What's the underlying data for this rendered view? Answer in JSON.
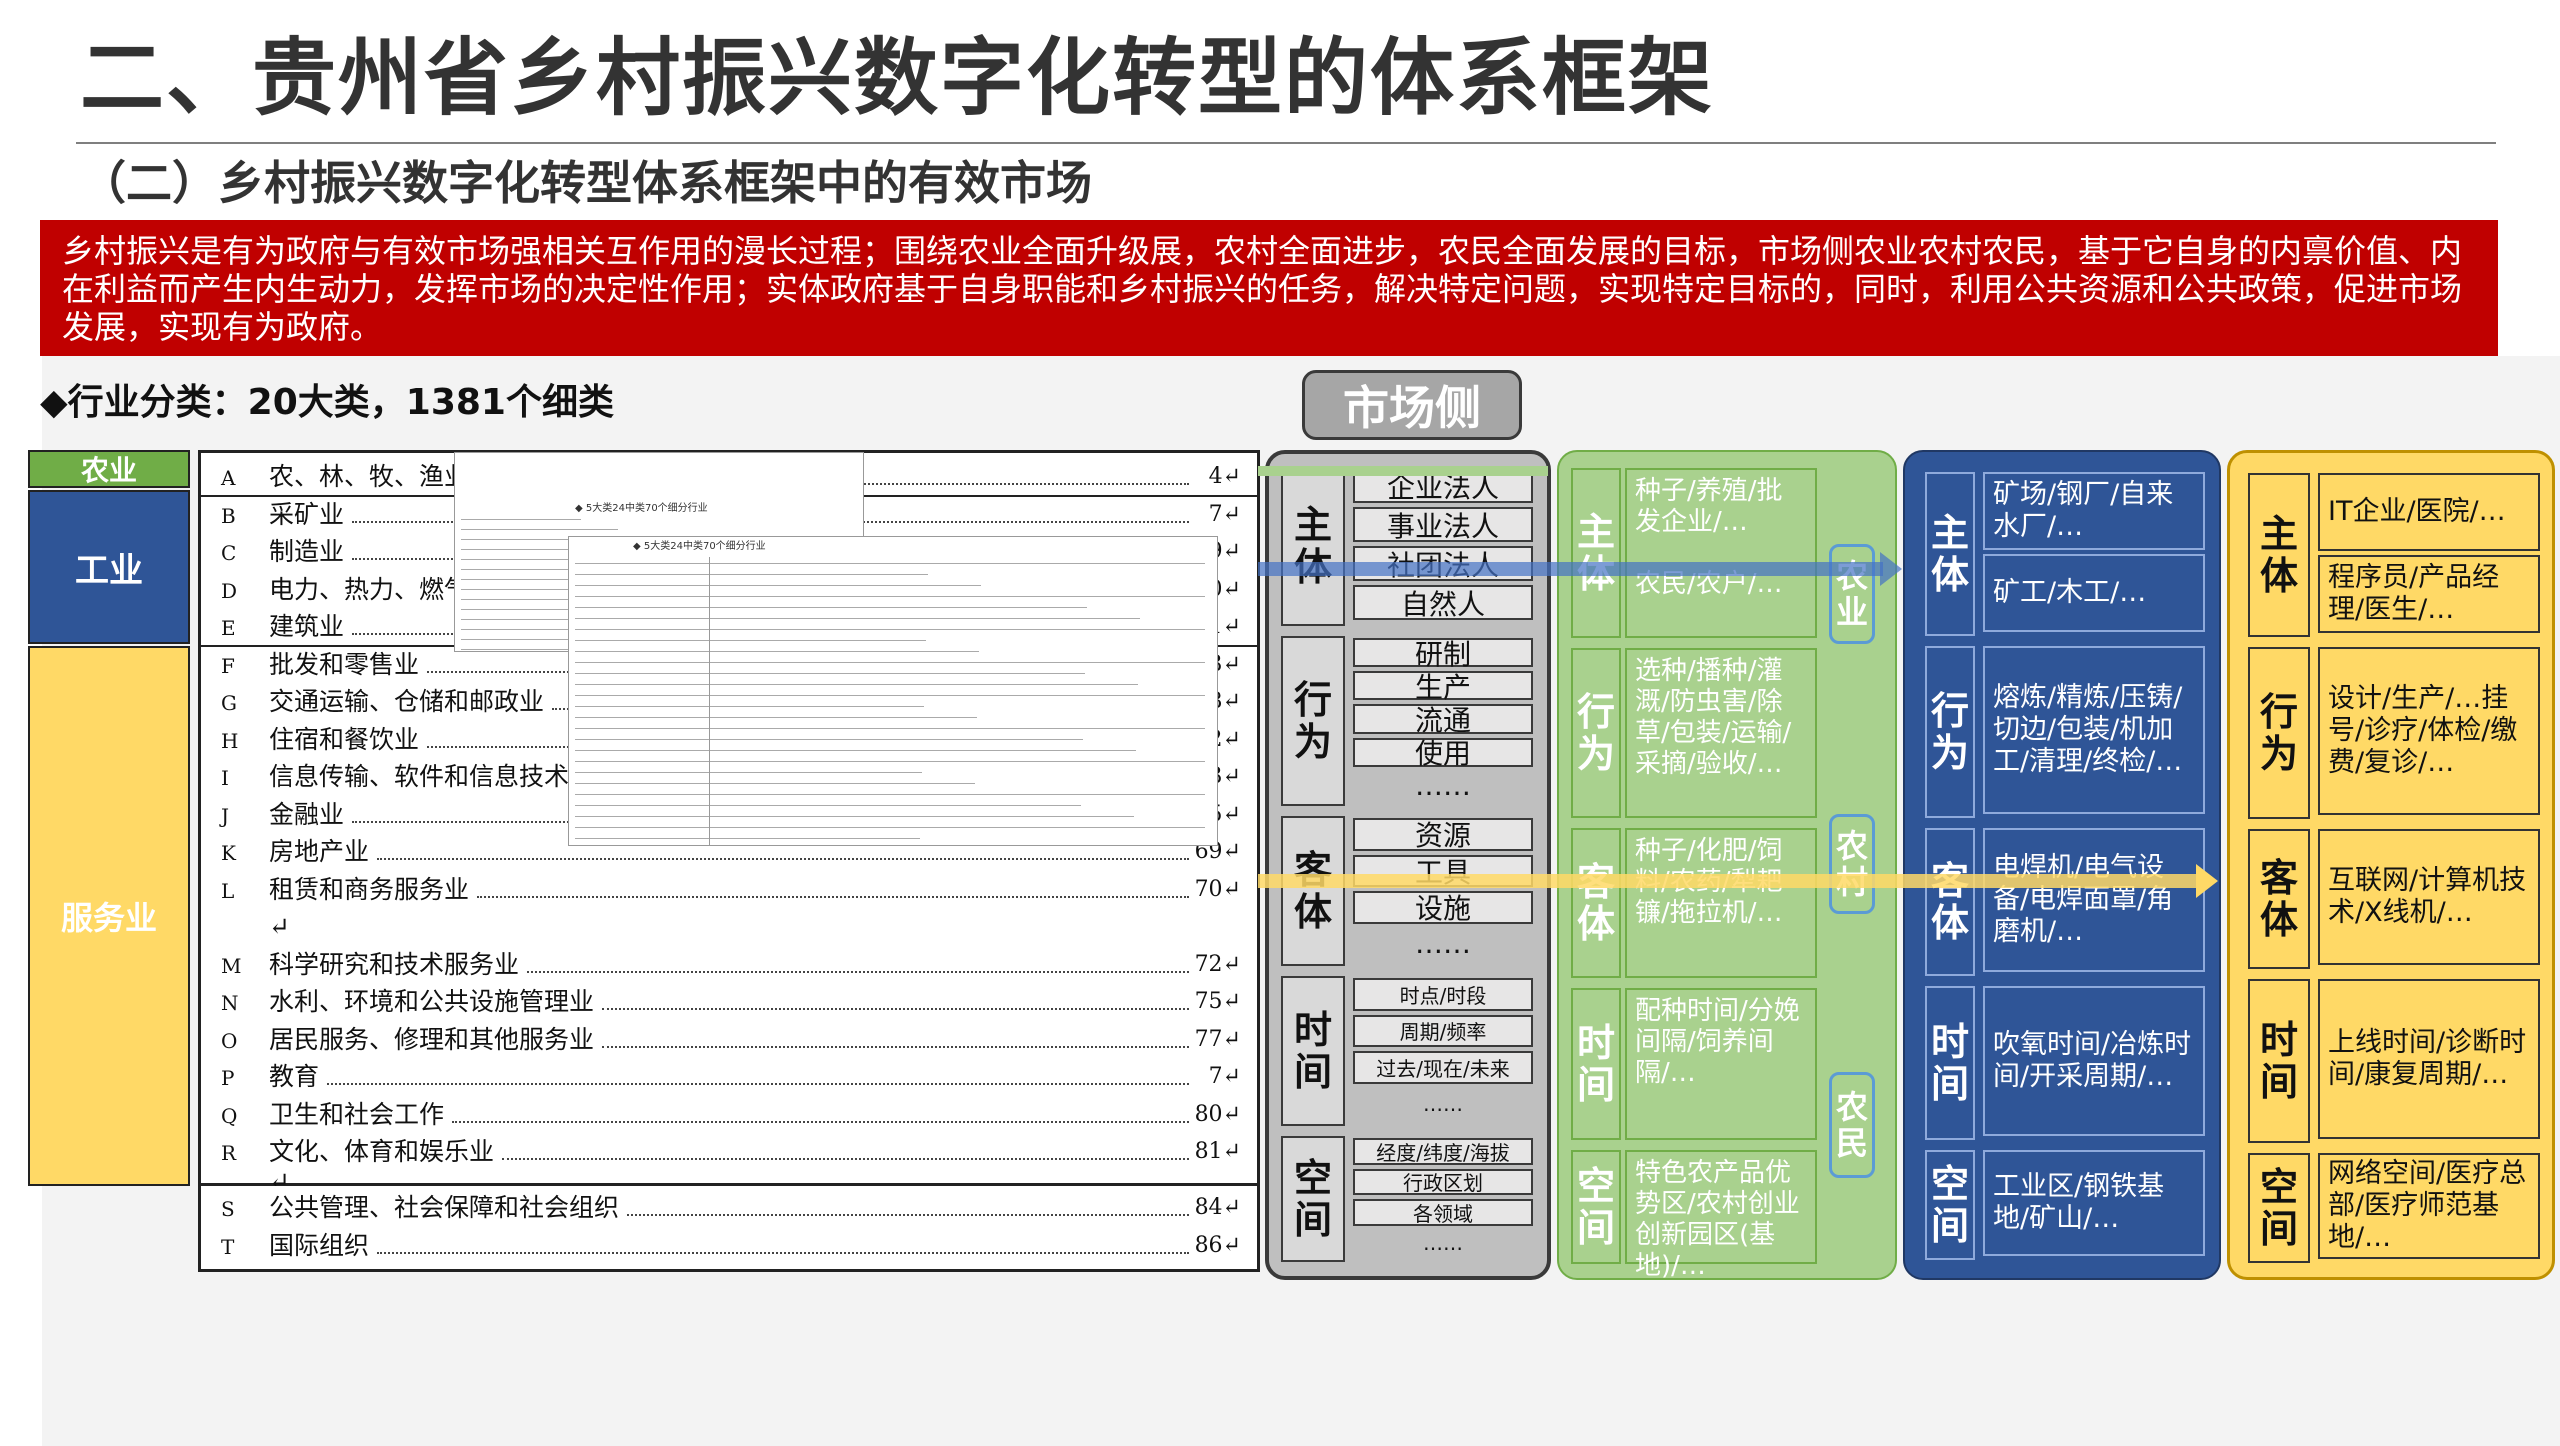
{
  "title": "二、贵州省乡村振兴数字化转型的体系框架",
  "subtitle": "（二）乡村振兴数字化转型体系框架中的有效市场",
  "intro": "乡村振兴是有为政府与有效市场强相关互作用的漫长过程；围绕农业全面升级展，农村全面进步，农民全面发展的目标，市场侧农业农村农民，基于它自身的内禀价值、内在利益而产生内生动力，发挥市场的决定性作用；实体政府基于自身职能和乡村振兴的任务，解决特定问题，实现特定目标的，同时，利用公共资源和公共政策，促进市场发展，实现有为政府。",
  "industry": {
    "heading": "◆行业分类：20大类，1381个细类",
    "categories": [
      {
        "label": "农业",
        "color": "#70ad47",
        "text_color": "#ffffff"
      },
      {
        "label": "工业",
        "color": "#2f5597",
        "text_color": "#ffffff"
      },
      {
        "label": "服务业",
        "color": "#ffd966",
        "text_color": "#ffffff"
      }
    ],
    "rows": [
      {
        "code": "A",
        "name": "农、林、牧、渔业",
        "page": "4↵"
      },
      {
        "code": "B",
        "name": "采矿业",
        "page": "7↵"
      },
      {
        "code": "C",
        "name": "制造业",
        "page": "9↵"
      },
      {
        "code": "D",
        "name": "电力、热力、燃气",
        "page": "50↵"
      },
      {
        "code": "E",
        "name": "建筑业",
        "page": "51↵"
      },
      {
        "code": "F",
        "name": "批发和零售业",
        "page": "53↵"
      },
      {
        "code": "G",
        "name": "交通运输、仓储和邮政业",
        "page": "58↵"
      },
      {
        "code": "H",
        "name": "住宿和餐饮业",
        "page": "62↵"
      },
      {
        "code": "I",
        "name": "信息传输、软件和信息技术服",
        "page": "63↵"
      },
      {
        "code": "J",
        "name": "金融业",
        "page": "65↵"
      },
      {
        "code": "K",
        "name": "房地产业",
        "page": "69↵"
      },
      {
        "code": "L",
        "name": "租赁和商务服务业",
        "page": "70↵"
      },
      {
        "code": "",
        "name": "↵",
        "page": ""
      },
      {
        "code": "M",
        "name": "科学研究和技术服务业",
        "page": "72↵"
      },
      {
        "code": "N",
        "name": "水利、环境和公共设施管理业",
        "page": "75↵"
      },
      {
        "code": "O",
        "name": "居民服务、修理和其他服务业",
        "page": "77↵"
      },
      {
        "code": "P",
        "name": "教育",
        "page": "7↵"
      },
      {
        "code": "Q",
        "name": "卫生和社会工作",
        "page": "80↵"
      },
      {
        "code": "R",
        "name": "文化、体育和娱乐业",
        "page": "81↵"
      },
      {
        "code": "",
        "name": "↵",
        "page": ""
      },
      {
        "code": "S",
        "name": "公共管理、社会保障和社会组织",
        "page": "84↵"
      },
      {
        "code": "T",
        "name": "国际组织",
        "page": "86↵"
      }
    ],
    "overlay_doc": {
      "line1": "◆ 5大类24中类70个细分行业",
      "line2": "◆ 5大类24中类70个细分行业",
      "line3": "◆ 5大类24中类70个细分行业"
    }
  },
  "market_tag": "市场侧",
  "gray_panel": {
    "sections": [
      {
        "label": "主\n体",
        "items": [
          "企业法人",
          "事业法人",
          "社团法人",
          "自然人"
        ]
      },
      {
        "label": "行\n为",
        "items": [
          "研制",
          "生产",
          "流通",
          "使用",
          "……"
        ]
      },
      {
        "label": "客\n体",
        "items": [
          "资源",
          "工具",
          "设施",
          "……"
        ]
      },
      {
        "label": "时\n间",
        "items": [
          "时点/时段",
          "周期/频率",
          "过去/现在/未来",
          "……"
        ]
      },
      {
        "label": "空\n间",
        "items": [
          "经度/纬度/海拔",
          "行政区划",
          "各领域",
          "……"
        ]
      }
    ]
  },
  "green_panel": {
    "sections": [
      {
        "label": "主\n体",
        "text": "种子/养殖/批发企业/…\n\n农民/农户/…"
      },
      {
        "label": "行\n为",
        "text": "选种/播种/灌溉/防虫害/除草/包装/运输/采摘/验收/…"
      },
      {
        "label": "客\n体",
        "text": "种子/化肥/饲料/农药/犁耙镰/拖拉机/…"
      },
      {
        "label": "时\n间",
        "text": "配种时间/分娩间隔/饲养间隔/…"
      },
      {
        "label": "空\n间",
        "text": "特色农产品优势区/农村创业创新园区(基地)/…"
      }
    ],
    "side_tags": [
      "农\n业",
      "农\n村",
      "农\n民"
    ]
  },
  "blue_panel": {
    "sections": [
      {
        "label": "主\n体",
        "items": [
          "矿场/钢厂/自来水厂/…",
          "矿工/木工/…"
        ]
      },
      {
        "label": "行\n为",
        "items": [
          "熔炼/精炼/压铸/切边/包装/机加工/清理/终检/…"
        ]
      },
      {
        "label": "客\n体",
        "items": [
          "电焊机/电气设备/电焊面罩/角磨机/…"
        ]
      },
      {
        "label": "时\n间",
        "items": [
          "吹氧时间/冶炼时间/开采周期/…"
        ]
      },
      {
        "label": "空\n间",
        "items": [
          "工业区/钢铁基地/矿山/…"
        ]
      }
    ]
  },
  "yellow_panel": {
    "sections": [
      {
        "label": "主\n体",
        "items": [
          "IT企业/医院/…",
          "程序员/产品经理/医生/…"
        ]
      },
      {
        "label": "行\n为",
        "items": [
          "设计/生产/…挂号/诊疗/体检/缴费/复诊/…"
        ]
      },
      {
        "label": "客\n体",
        "items": [
          "互联网/计算机技术/X线机/…"
        ]
      },
      {
        "label": "时\n间",
        "items": [
          "上线时间/诊断时间/康复周期/…"
        ]
      },
      {
        "label": "空\n间",
        "items": [
          "网络空间/医疗总部/医疗师范基地/…"
        ]
      }
    ]
  },
  "colors": {
    "red": "#c00000",
    "green": "#a9d18e",
    "blue": "#2f5597",
    "yellow": "#ffd966",
    "gray": "#bfbfbf"
  }
}
